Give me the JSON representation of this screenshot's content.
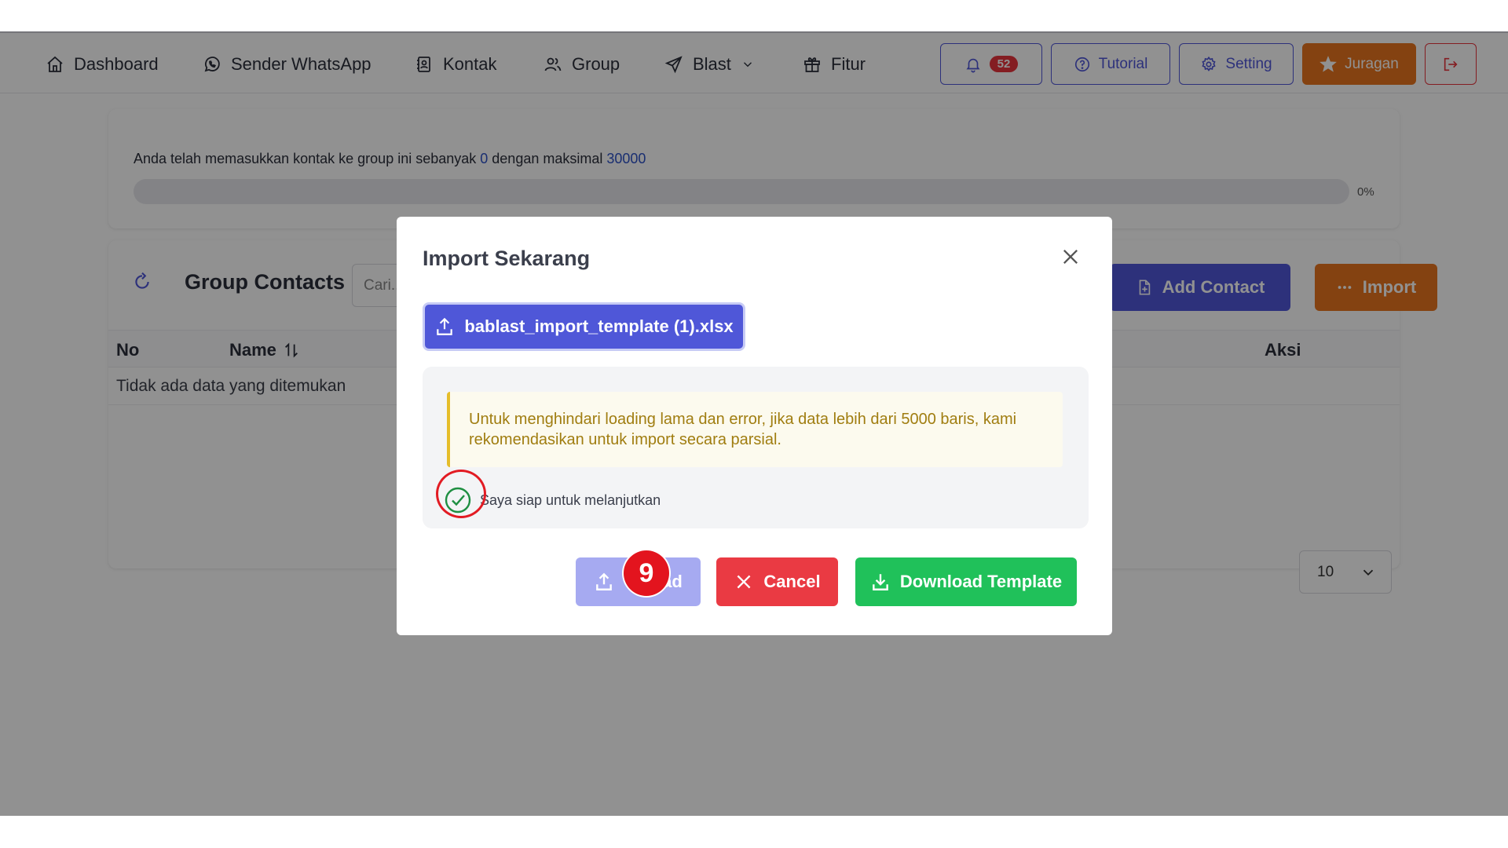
{
  "nav": {
    "items": [
      {
        "label": "Dashboard",
        "icon": "home-icon"
      },
      {
        "label": "Sender WhatsApp",
        "icon": "whatsapp-icon"
      },
      {
        "label": "Kontak",
        "icon": "contact-book-icon"
      },
      {
        "label": "Group",
        "icon": "users-icon"
      },
      {
        "label": "Blast",
        "icon": "send-icon"
      },
      {
        "label": "Fitur",
        "icon": "gift-icon"
      }
    ],
    "notification_count": "52",
    "tutorial_label": "Tutorial",
    "setting_label": "Setting",
    "juragan_label": "Juragan"
  },
  "quota": {
    "text_before": "Anda telah memasukkan kontak ke group ini sebanyak ",
    "count": "0",
    "text_middle": " dengan maksimal ",
    "max": "30000",
    "progress_percent": 0,
    "progress_label": "0%"
  },
  "group": {
    "title": "Group Contacts",
    "search_placeholder": "Cari...",
    "add_contact_label": "Add Contact",
    "import_label": "Import",
    "columns": {
      "no": "No",
      "name": "Name",
      "aksi": "Aksi"
    },
    "empty_text": "Tidak ada data yang ditemukan",
    "page_size": "10"
  },
  "modal": {
    "title": "Import Sekarang",
    "file_name": "bablast_import_template (1).xlsx",
    "alert_text": "Untuk menghindari loading lama dan error, jika data lebih dari 5000 baris, kami rekomendasikan untuk import secara parsial.",
    "checkbox_label": "Saya siap untuk melanjutkan",
    "upload_label": "Upload",
    "cancel_label": "Cancel",
    "download_label": "Download Template",
    "step_number": "9"
  },
  "colors": {
    "primary": "#4f57d8",
    "orange": "#e8741e",
    "danger": "#ea3a43",
    "success": "#20c15a",
    "warning_text": "#a07d10"
  }
}
